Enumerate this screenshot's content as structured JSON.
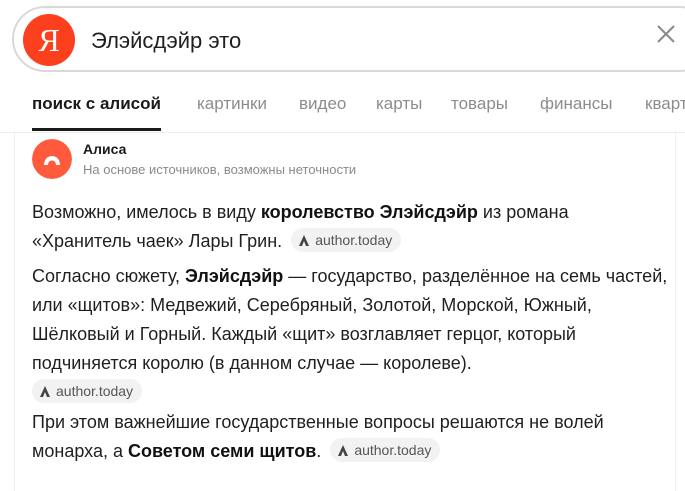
{
  "search": {
    "logo_letter": "Я",
    "query": "Элэйсдэйр это"
  },
  "tabs": [
    {
      "label": "поиск с алисой",
      "active": true
    },
    {
      "label": "картинки"
    },
    {
      "label": "видео"
    },
    {
      "label": "карты"
    },
    {
      "label": "товары"
    },
    {
      "label": "финансы"
    },
    {
      "label": "кварт"
    }
  ],
  "answer": {
    "author": "Алиса",
    "disclaimer": "На основе источников, возможны неточности",
    "p1": {
      "a": "Возможно, имелось в виду ",
      "b": "королевство Элэйсдэйр",
      "c": " из романа «Хранитель чаек» Лары Грин.",
      "source": "author.today"
    },
    "p2": {
      "a": "Согласно сюжету, ",
      "b": "Элэйсдэйр",
      "c": " — государство, разделённое на семь частей, или «щитов»: Медвежий, Серебряный, Золотой, Морской, Южный, Шёлковый и Горный. Каждый «щит» возглавляет герцог, который подчиняется королю (в данном случае — королеве).",
      "source": "author.today"
    },
    "p3": {
      "a": "При этом важнейшие государственные вопросы решаются не волей монарха, а ",
      "b": "Советом семи щитов",
      "c": ".",
      "source": "author.today"
    }
  },
  "colors": {
    "brand": "#fc3f1d",
    "alice": "#ff5a3c",
    "tab_inactive": "#8c8c8c",
    "source_chip_bg": "#f2f2f2"
  }
}
